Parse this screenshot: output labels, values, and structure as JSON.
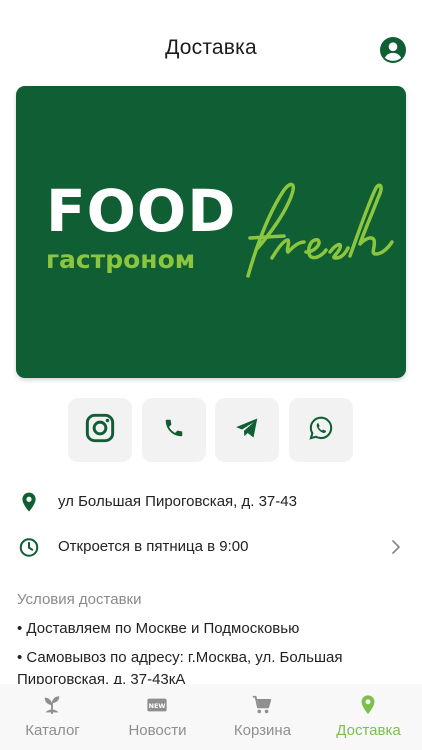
{
  "header": {
    "title": "Доставка",
    "profile_icon": "account-circle-icon"
  },
  "banner": {
    "logo_main": "FOOD",
    "logo_sub": "гастроном",
    "logo_script": "fresh",
    "background": "#0f5e34",
    "accent": "#8cc63f"
  },
  "socials": [
    {
      "icon": "instagram-icon"
    },
    {
      "icon": "phone-icon"
    },
    {
      "icon": "telegram-icon"
    },
    {
      "icon": "whatsapp-icon"
    }
  ],
  "info": {
    "address": "ул Большая Пироговская, д. 37-43",
    "hours": "Откроется в пятница в 9:00"
  },
  "delivery": {
    "section_title": "Условия доставки",
    "items": [
      "• Доставляем по Москве и Подмосковью",
      "• Самовывоз по адресу: г.Москва, ул. Большая Пироговская, д. 37-43кА"
    ]
  },
  "tabbar": {
    "items": [
      {
        "label": "Каталог",
        "icon": "sprout-icon",
        "active": false
      },
      {
        "label": "Новости",
        "icon": "new-badge-icon",
        "active": false
      },
      {
        "label": "Корзина",
        "icon": "cart-icon",
        "active": false
      },
      {
        "label": "Доставка",
        "icon": "location-pin-icon",
        "active": true
      }
    ],
    "active_color": "#7cbf4a"
  },
  "colors": {
    "brand_green": "#0f5e34",
    "accent_green": "#7cbf4a"
  }
}
